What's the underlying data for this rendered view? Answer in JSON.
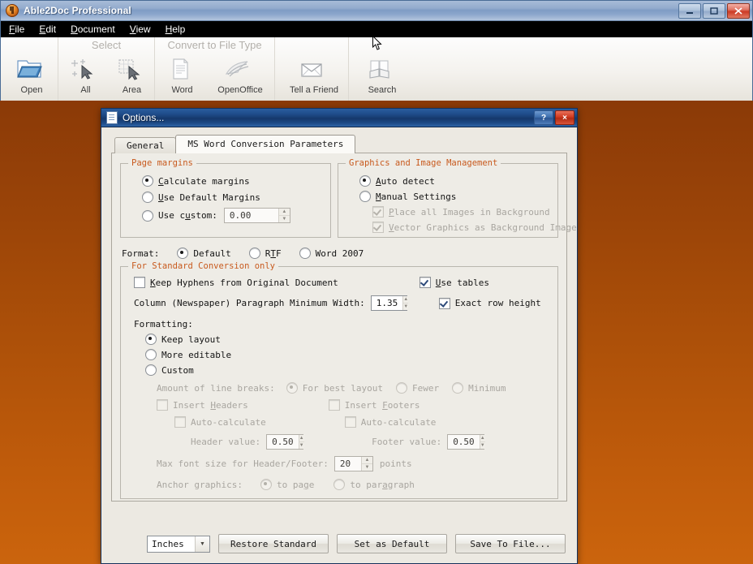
{
  "app": {
    "title": "Able2Doc Professional",
    "icon": "app-logo-icon",
    "window_buttons": {
      "minimize": "minimize-icon",
      "maximize": "maximize-icon",
      "close": "close-icon"
    },
    "menu": [
      {
        "label": "File",
        "accel": "F"
      },
      {
        "label": "Edit",
        "accel": "E"
      },
      {
        "label": "Document",
        "accel": "D"
      },
      {
        "label": "View",
        "accel": "V"
      },
      {
        "label": "Help",
        "accel": "H"
      }
    ],
    "ribbon": [
      {
        "title": "",
        "items": [
          {
            "label": "Open",
            "icon": "open-folder-icon"
          }
        ]
      },
      {
        "title": "Select",
        "items": [
          {
            "label": "All",
            "icon": "select-all-icon"
          },
          {
            "label": "Area",
            "icon": "select-area-icon"
          }
        ]
      },
      {
        "title": "Convert to File Type",
        "items": [
          {
            "label": "Word",
            "icon": "word-document-icon"
          },
          {
            "label": "OpenOffice",
            "icon": "openoffice-icon"
          }
        ]
      },
      {
        "title": "",
        "items": [
          {
            "label": "Tell a Friend",
            "icon": "envelope-icon"
          }
        ]
      },
      {
        "title": "",
        "items": [
          {
            "label": "Search",
            "icon": "search-books-icon"
          }
        ]
      }
    ]
  },
  "dialog": {
    "title": "Options...",
    "icon": "document-options-icon",
    "help_button": "?",
    "close_button": "×",
    "tabs": [
      {
        "label": "General",
        "active": false
      },
      {
        "label": "MS Word Conversion Parameters",
        "active": true
      }
    ],
    "page_margins": {
      "legend": "Page margins",
      "options": [
        {
          "label": "Calculate margins",
          "accel": "C",
          "selected": true
        },
        {
          "label": "Use Default Margins",
          "accel": "U",
          "selected": false
        },
        {
          "label": "Use custom:",
          "accel": "u",
          "selected": false
        }
      ],
      "custom_value": "0.00"
    },
    "graphics": {
      "legend": "Graphics and Image Management",
      "options": [
        {
          "label": "Auto detect",
          "accel": "A",
          "selected": true
        },
        {
          "label": "Manual Settings",
          "accel": "M",
          "selected": false
        }
      ],
      "checkboxes": [
        {
          "label": "Place all Images in Background",
          "accel": "P",
          "checked": true,
          "enabled": false
        },
        {
          "label": "Vector Graphics as Background Image",
          "accel": "V",
          "checked": true,
          "enabled": false
        }
      ]
    },
    "format": {
      "label": "Format:",
      "options": [
        {
          "label": "Default",
          "selected": true
        },
        {
          "label": "RTF",
          "accel": "T",
          "selected": false
        },
        {
          "label": "Word 2007",
          "selected": false
        }
      ]
    },
    "standard_conversion": {
      "legend": "For Standard Conversion only",
      "keep_hyphens": {
        "label": "Keep Hyphens from Original Document",
        "accel": "K",
        "checked": false,
        "enabled": true
      },
      "use_tables": {
        "label": "Use tables",
        "accel": "U",
        "checked": true,
        "enabled": true
      },
      "exact_row_height": {
        "label": "Exact row height",
        "checked": true,
        "enabled": true
      },
      "column_width": {
        "label": "Column (Newspaper) Paragraph Minimum Width:",
        "value": "1.35"
      },
      "formatting_label": "Formatting:",
      "formatting_options": [
        {
          "label": "Keep layout",
          "selected": true
        },
        {
          "label": "More editable",
          "selected": false
        },
        {
          "label": "Custom",
          "selected": false
        }
      ],
      "line_breaks": {
        "label": "Amount of line breaks:",
        "options": [
          {
            "label": "For best layout",
            "selected": true
          },
          {
            "label": "Fewer",
            "selected": false
          },
          {
            "label": "Minimum",
            "selected": false
          }
        ]
      },
      "insert_headers": {
        "label": "Insert Headers",
        "accel": "H",
        "checked": false
      },
      "insert_footers": {
        "label": "Insert Footers",
        "accel": "F",
        "checked": false
      },
      "auto_calculate_header": {
        "label": "Auto-calculate",
        "checked": false
      },
      "auto_calculate_footer": {
        "label": "Auto-calculate",
        "checked": false
      },
      "header_value": {
        "label": "Header value:",
        "value": "0.50"
      },
      "footer_value": {
        "label": "Footer value:",
        "value": "0.50"
      },
      "max_font_size": {
        "label": "Max font size for Header/Footer:",
        "value": "20",
        "units": "points"
      },
      "anchor_graphics": {
        "label": "Anchor graphics:",
        "options": [
          {
            "label": "to page",
            "accel": "g",
            "selected": true
          },
          {
            "label": "to paragraph",
            "accel": "a",
            "selected": false
          }
        ]
      }
    },
    "footer": {
      "units_value": "Inches",
      "restore_standard": "Restore Standard",
      "set_as_default": "Set as Default",
      "save_to_file": "Save To File..."
    }
  },
  "colors": {
    "desktop_top": "#7d3205",
    "desktop_bottom": "#cb640d",
    "legend_orange": "#c85a1e",
    "dialog_title_blue": "#1f4c8a",
    "close_red": "#cf3a20"
  }
}
